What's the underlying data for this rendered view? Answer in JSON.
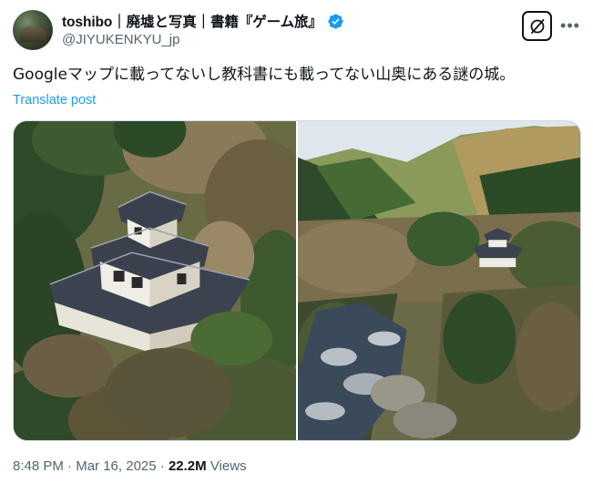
{
  "author": {
    "display_name": "toshibo｜廃墟と写真｜書籍『ゲーム旅』",
    "handle": "@JIYUKENKYU_jp",
    "verified_color": "#1d9bf0"
  },
  "post": {
    "text": "Googleマップに載ってないし教科書にも載ってない山奥にある謎の城。",
    "translate_label": "Translate post"
  },
  "media": {
    "photos": [
      {
        "subject": "castle-close-aerial-icon"
      },
      {
        "subject": "castle-valley-river-icon"
      }
    ]
  },
  "meta": {
    "time": "8:48 PM",
    "separator": " · ",
    "date": "Mar 16, 2025",
    "views_count": "22.2M",
    "views_label": " Views"
  },
  "icons": {
    "grok": "grok-icon",
    "more": "more-options-icon"
  }
}
